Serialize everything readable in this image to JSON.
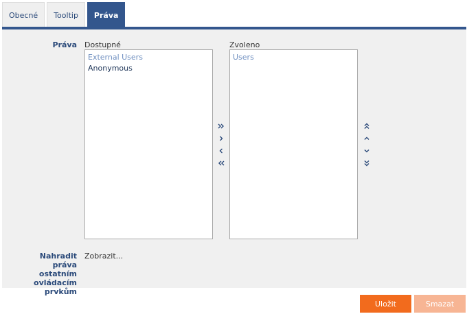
{
  "tabs": [
    {
      "label": "Obecné"
    },
    {
      "label": "Tooltip"
    },
    {
      "label": "Práva"
    }
  ],
  "rights": {
    "label": "Práva",
    "available": {
      "caption": "Dostupné",
      "items": [
        {
          "label": "External Users"
        },
        {
          "label": "Anonymous"
        }
      ]
    },
    "selected": {
      "caption": "Zvoleno",
      "items": [
        {
          "label": "Users"
        }
      ]
    }
  },
  "replace_rights": {
    "label_lines": [
      "Nahradit práva",
      "ostatním",
      "ovládacím",
      "prvkům"
    ],
    "link": "Zobrazit..."
  },
  "buttons": {
    "save": "Uložit",
    "delete": "Smazat"
  },
  "colors": {
    "accent": "#33568d",
    "primary_button": "#f26b1d",
    "disabled_button": "#f7b594"
  },
  "icons": {
    "move_all_right": "double-chevron-right-icon",
    "move_right": "chevron-right-icon",
    "move_left": "chevron-left-icon",
    "move_all_left": "double-chevron-left-icon",
    "move_top": "double-chevron-up-icon",
    "move_up": "chevron-up-icon",
    "move_down": "chevron-down-icon",
    "move_bottom": "double-chevron-down-icon"
  }
}
